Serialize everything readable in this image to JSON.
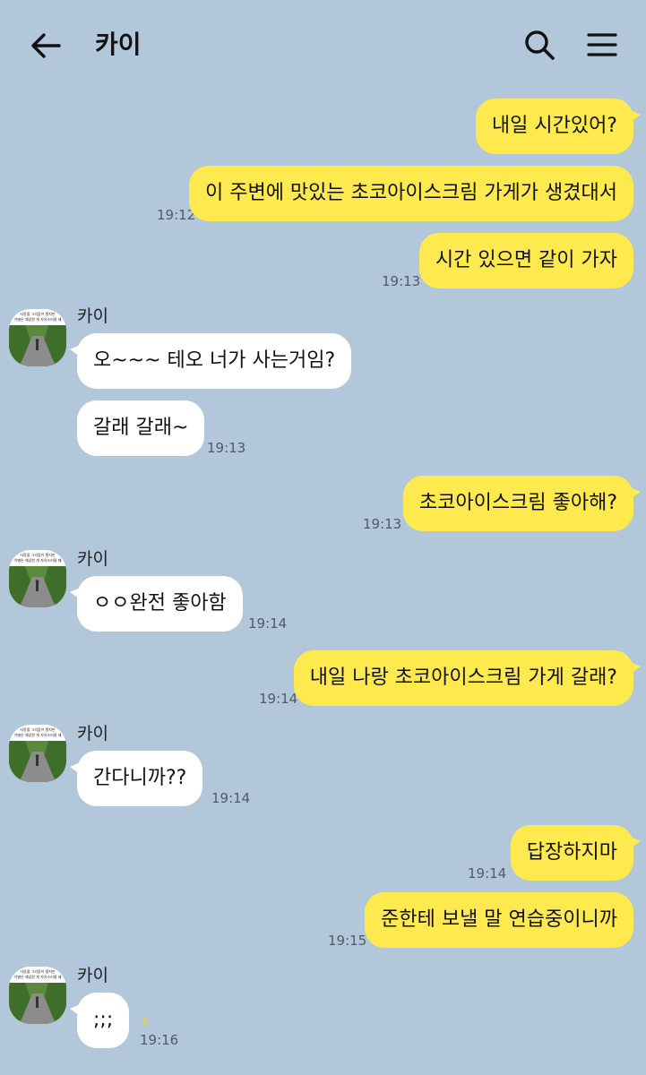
{
  "header": {
    "title": "카이",
    "back_icon": "arrow-left-icon",
    "search_icon": "search-icon",
    "menu_icon": "hamburger-menu-icon"
  },
  "colors": {
    "background": "#b2c7da",
    "my_bubble": "#fee94e",
    "their_bubble": "#ffffff",
    "unread_count": "#f5d21a"
  },
  "avatar_caption": {
    "line1": "사랑을 그리움이 됐지만",
    "line2": "이별은 체념한 게 자유스러울 때"
  },
  "messages": [
    {
      "side": "me",
      "text": "내일 시간있어?",
      "time": ""
    },
    {
      "side": "me",
      "text": "이 주변에 맛있는 초코아이스크림 가게가 생겼대서",
      "time": "19:12"
    },
    {
      "side": "me",
      "text": "시간 있으면 같이 가자",
      "time": "19:13"
    },
    {
      "side": "them",
      "sender": "카이",
      "text": "오~~~ 테오 너가 사는거임?",
      "time": ""
    },
    {
      "side": "them",
      "text": "갈래 갈래~",
      "time": "19:13"
    },
    {
      "side": "me",
      "text": "초코아이스크림 좋아해?",
      "time": "19:13"
    },
    {
      "side": "them",
      "sender": "카이",
      "text": "ㅇㅇ완전 좋아함",
      "time": "19:14"
    },
    {
      "side": "me",
      "text": "내일 나랑 초코아이스크림 가게 갈래?",
      "time": "19:14"
    },
    {
      "side": "them",
      "sender": "카이",
      "text": "간다니까??",
      "time": "19:14"
    },
    {
      "side": "me",
      "text": "답장하지마",
      "time": "19:14"
    },
    {
      "side": "me",
      "text": "준한테 보낼 말 연습중이니까",
      "time": "19:15"
    },
    {
      "side": "them",
      "sender": "카이",
      "text": ";;;",
      "time": "19:16",
      "unread": "1"
    }
  ]
}
